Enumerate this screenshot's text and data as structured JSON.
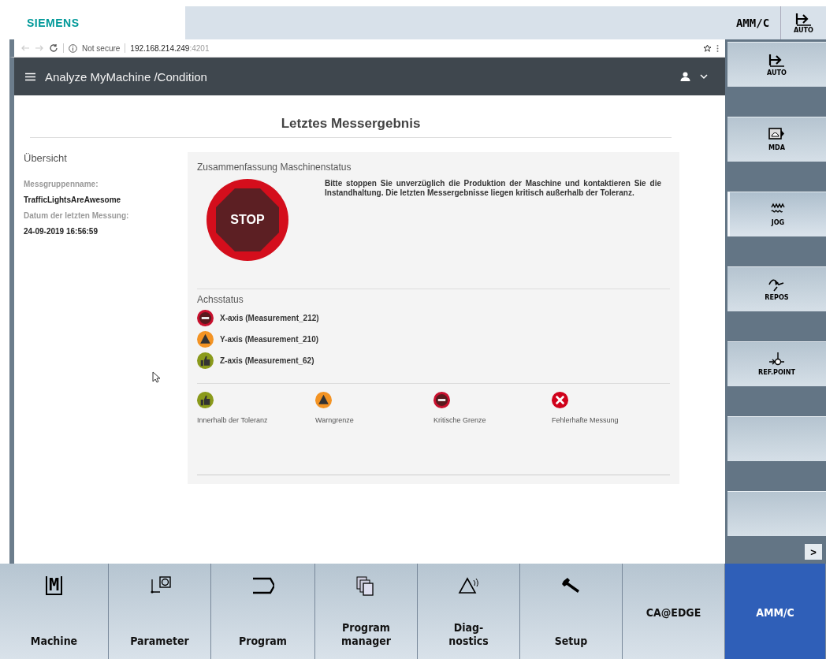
{
  "header": {
    "logo": "SIEMENS",
    "channel": "AMM/C",
    "mode_key": {
      "label": "AUTO",
      "kind": "auto"
    }
  },
  "browser": {
    "security": "Not secure",
    "host": "192.168.214.249",
    "port": ":4201"
  },
  "app_bar": {
    "title": "Analyze MyMachine /Condition"
  },
  "page": {
    "title": "Letztes Messergebnis"
  },
  "overview": {
    "heading": "Übersicht",
    "fields": [
      {
        "label": "Messgruppenname:",
        "value": "TrafficLightsAreAwesome"
      },
      {
        "label": "Datum der letzten Messung:",
        "value": "24-09-2019 16:56:59"
      }
    ]
  },
  "summary": {
    "heading": "Zusammenfassung Maschinenstatus",
    "sign": "STOP",
    "message": "Bitte stoppen Sie unverzüglich die Produktion der Maschine und kontaktieren Sie die Instandhaltung. Die letzten Messergebnisse liegen kritisch außerhalb der Toleranz."
  },
  "axis_status": {
    "heading": "Achsstatus",
    "axes": [
      {
        "label": "X-axis (Measurement_212)",
        "kind": "critical"
      },
      {
        "label": "Y-axis (Measurement_210)",
        "kind": "warning"
      },
      {
        "label": "Z-axis (Measurement_62)",
        "kind": "ok"
      }
    ]
  },
  "legend": [
    {
      "label": "Innerhalb der Toleranz",
      "kind": "ok"
    },
    {
      "label": "Warngrenze",
      "kind": "warning"
    },
    {
      "label": "Kritische Grenze",
      "kind": "critical"
    },
    {
      "label": "Fehlerhafte Messung",
      "kind": "error"
    }
  ],
  "vertical_softkeys": [
    {
      "label": "AUTO",
      "kind": "auto",
      "selected": false
    },
    {
      "label": "MDA",
      "kind": "mda",
      "selected": false
    },
    {
      "label": "JOG",
      "kind": "jog",
      "selected": true
    },
    {
      "label": "REPOS",
      "kind": "repos",
      "selected": false
    },
    {
      "label": "REF.POINT",
      "kind": "refpoint",
      "selected": false
    },
    {
      "kind": "empty",
      "selected": false
    },
    {
      "kind": "empty",
      "selected": false
    }
  ],
  "more_key": ">",
  "horizontal_softkeys": [
    {
      "label": "Machine",
      "kind": "machine",
      "icon_text": "M",
      "selected": false
    },
    {
      "label": "Parameter",
      "kind": "parameter",
      "selected": false
    },
    {
      "label": "Program",
      "kind": "program",
      "selected": false
    },
    {
      "label": "Program manager",
      "kind": "manager",
      "selected": false
    },
    {
      "label": "Diag-\nnostics",
      "kind": "diagnostics",
      "selected": false
    },
    {
      "label": "Setup",
      "kind": "setup",
      "selected": false
    },
    {
      "label": "CA@EDGE",
      "kind": "text",
      "selected": false
    },
    {
      "label": "AMM/C",
      "kind": "text",
      "selected": true
    }
  ]
}
